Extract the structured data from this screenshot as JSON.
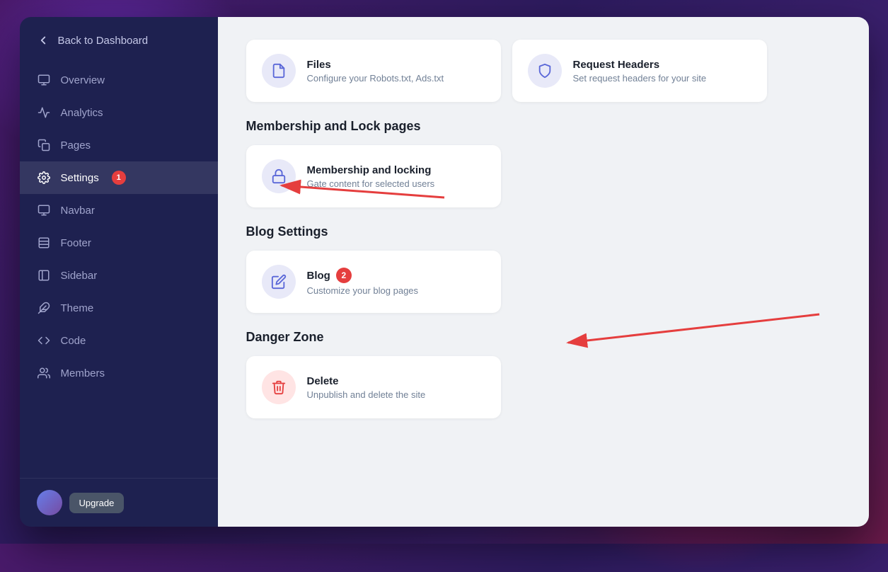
{
  "sidebar": {
    "back_label": "Back to Dashboard",
    "items": [
      {
        "id": "overview",
        "label": "Overview",
        "icon": "monitor",
        "active": false,
        "badge": null
      },
      {
        "id": "analytics",
        "label": "Analytics",
        "icon": "trending-up",
        "active": false,
        "badge": null
      },
      {
        "id": "pages",
        "label": "Pages",
        "icon": "copy",
        "active": false,
        "badge": null
      },
      {
        "id": "settings",
        "label": "Settings",
        "icon": "settings",
        "active": true,
        "badge": 1
      },
      {
        "id": "navbar",
        "label": "Navbar",
        "icon": "monitor",
        "active": false,
        "badge": null
      },
      {
        "id": "footer",
        "label": "Footer",
        "icon": "layout",
        "active": false,
        "badge": null
      },
      {
        "id": "sidebar",
        "label": "Sidebar",
        "icon": "sidebar",
        "active": false,
        "badge": null
      },
      {
        "id": "theme",
        "label": "Theme",
        "icon": "feather",
        "active": false,
        "badge": null
      },
      {
        "id": "code",
        "label": "Code",
        "icon": "code",
        "active": false,
        "badge": null
      },
      {
        "id": "members",
        "label": "Members",
        "icon": "users",
        "active": false,
        "badge": null
      }
    ]
  },
  "main": {
    "sections": [
      {
        "id": "membership-lock",
        "title": "Membership and Lock pages",
        "cards": [
          {
            "id": "membership-locking",
            "title": "Membership and locking",
            "desc": "Gate content for selected users",
            "icon": "lock",
            "badge": null,
            "danger": false
          }
        ]
      },
      {
        "id": "blog-settings",
        "title": "Blog Settings",
        "cards": [
          {
            "id": "blog",
            "title": "Blog",
            "desc": "Customize your blog pages",
            "icon": "edit",
            "badge": 2,
            "danger": false
          }
        ]
      },
      {
        "id": "danger-zone",
        "title": "Danger Zone",
        "cards": [
          {
            "id": "delete",
            "title": "Delete",
            "desc": "Unpublish and delete the site",
            "icon": "trash",
            "badge": null,
            "danger": true
          }
        ]
      }
    ],
    "top_cards": [
      {
        "id": "files",
        "title": "Files",
        "desc": "Configure your Robots.txt, Ads.txt",
        "icon": "file",
        "badge": null,
        "danger": false
      },
      {
        "id": "request-headers",
        "title": "Request Headers",
        "desc": "Set request headers for your site",
        "icon": "shield",
        "badge": null,
        "danger": false
      }
    ]
  },
  "colors": {
    "sidebar_bg": "#1e2150",
    "sidebar_active": "rgba(255,255,255,0.1)",
    "accent": "#5a67d8",
    "badge_red": "#e53e3e",
    "card_icon_bg": "#e8e9f8",
    "danger_icon_bg": "#ffe4e4"
  }
}
